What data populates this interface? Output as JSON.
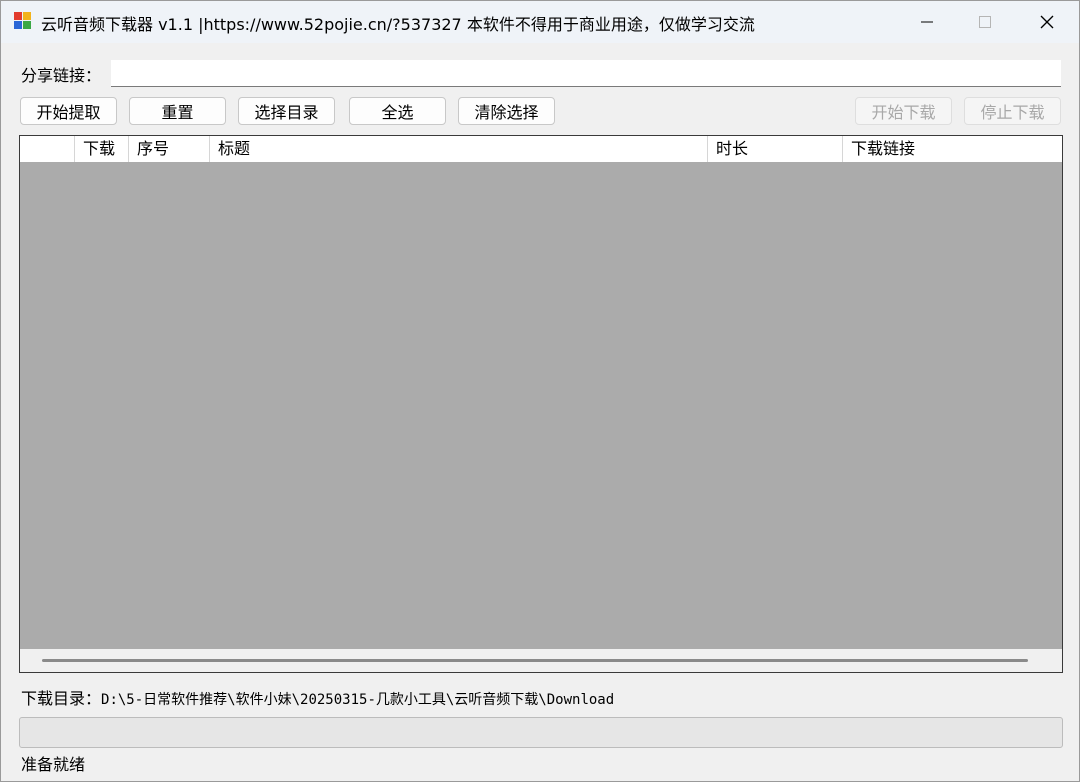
{
  "window": {
    "title": "云听音频下载器 v1.1 |https://www.52pojie.cn/?537327 本软件不得用于商业用途，仅做学习交流",
    "controls": [
      "minimize-icon",
      "maximize-icon",
      "close-icon"
    ]
  },
  "share": {
    "label": "分享链接：",
    "value": ""
  },
  "toolbar": {
    "start_extract": "开始提取",
    "reset": "重置",
    "choose_dir": "选择目录",
    "select_all": "全选",
    "clear_selection": "清除选择",
    "start_download": "开始下载",
    "stop_download": "停止下载"
  },
  "table": {
    "columns": [
      "",
      "下载",
      "序号",
      "标题",
      "时长",
      "下载链接"
    ],
    "rows": []
  },
  "download_dir": {
    "label": "下载目录：",
    "path": "D:\\5-日常软件推荐\\软件小妹\\20250315-几款小工具\\云听音频下载\\Download"
  },
  "progress": {
    "value": 0
  },
  "status": {
    "text": "准备就绪"
  },
  "colors": {
    "titlebar": "#eff3f8",
    "grid_background": "#ababab",
    "window_background": "#f0f0f0"
  }
}
